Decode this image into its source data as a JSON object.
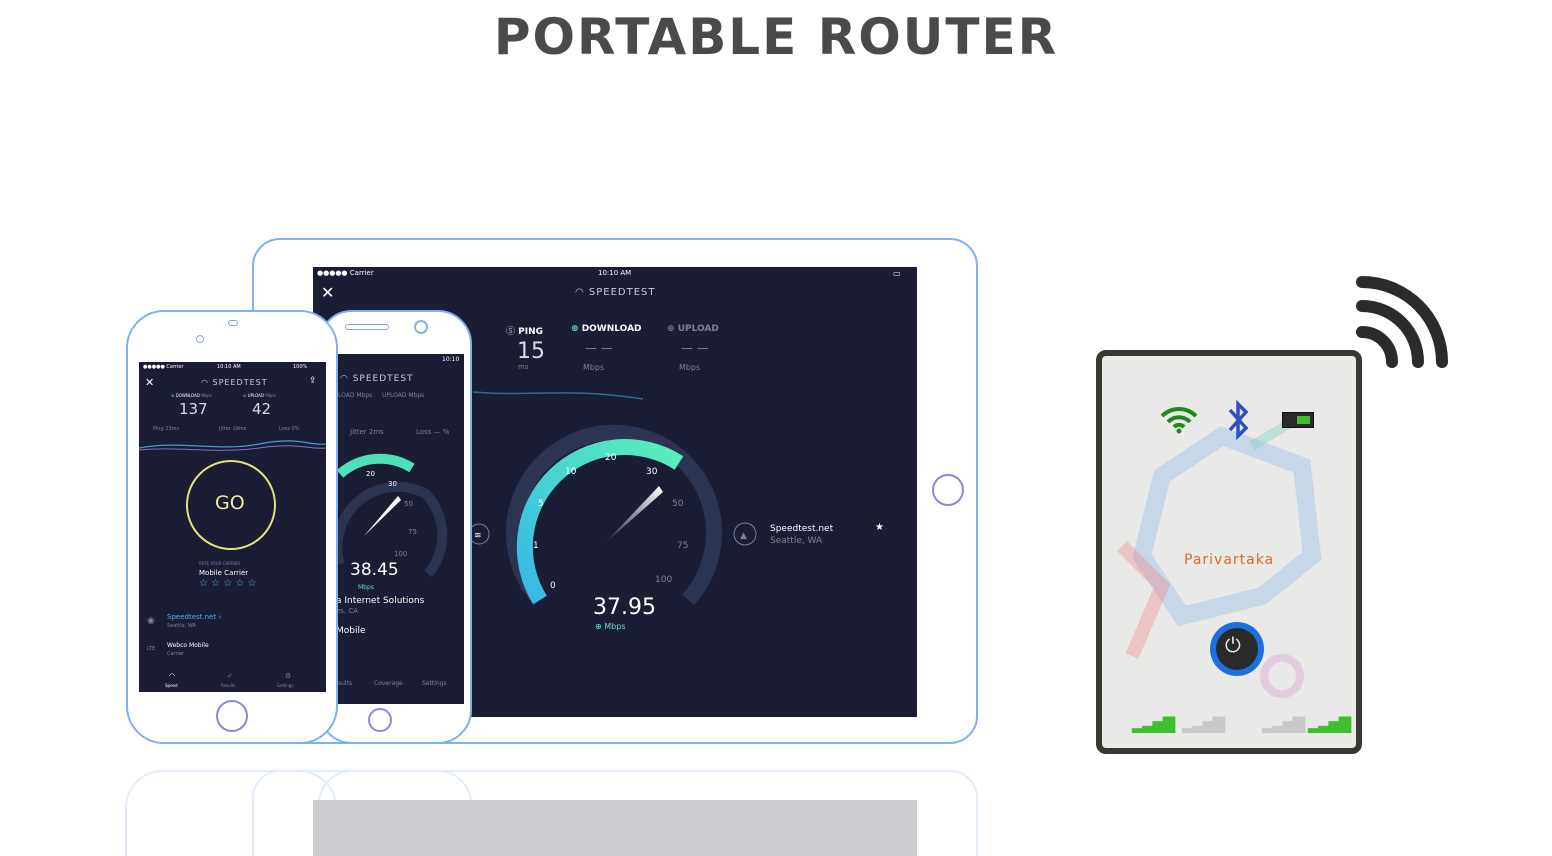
{
  "page": {
    "title": "PORTABLE ROUTER"
  },
  "tablet": {
    "status_carrier": "●●●●● Carrier",
    "status_time": "10:10 AM",
    "app_name": "SPEEDTEST",
    "ping_label": "PING",
    "ping_value": "15",
    "ping_unit": "ms",
    "download_label": "DOWNLOAD",
    "download_value": "— —",
    "download_unit": "Mbps",
    "upload_label": "UPLOAD",
    "upload_value": "— —",
    "upload_unit": "Mbps",
    "gauge_ticks": [
      "0",
      "1",
      "5",
      "10",
      "20",
      "30",
      "50",
      "75",
      "100"
    ],
    "gauge_value": "37.95",
    "gauge_unit": "Mbps",
    "server_name": "Speedtest.net",
    "server_location": "Seattle, WA"
  },
  "phone_mid": {
    "status_time": "10:10",
    "app_name": "SPEEDTEST",
    "download_label": "LOAD Mbps",
    "upload_label": "UPLOAD Mbps",
    "jitter": "Jitter  2ms",
    "loss": "Loss — %",
    "gauge_ticks": [
      "0",
      "20",
      "30",
      "50",
      "75",
      "100"
    ],
    "gauge_value": "38.45",
    "gauge_unit": "Mbps",
    "isp": "a Internet Solutions",
    "isp_loc": "es, CA",
    "carrier": "Mobile",
    "tabs": [
      "sults",
      "Coverage",
      "Settings"
    ]
  },
  "phone_front": {
    "status_carrier": "●●●●● Carrier",
    "status_time": "10:10 AM",
    "status_battery": "100%",
    "app_name": "SPEEDTEST",
    "download_label": "DOWNLOAD",
    "download_unit": "Mbps",
    "download_value": "137",
    "upload_label": "UPLOAD",
    "upload_unit": "Mbps",
    "upload_value": "42",
    "ping": "Ping  23ms",
    "jitter": "Jitter  19ms",
    "loss": "Loss  0%",
    "go_label": "GO",
    "rate_label": "RATE YOUR CARRIER",
    "carrier_name": "Mobile Carrier",
    "stars": "☆ ☆ ☆ ☆ ☆",
    "server_name": "Speedtest.net",
    "server_location": "Seattle, WA",
    "isp_name": "Webco Mobile",
    "isp_type": "Carrier",
    "tabs": [
      "Speed",
      "Results",
      "Settings"
    ]
  },
  "router": {
    "brand": "Parivartaka",
    "colors": {
      "wifi": "#1e8a1e",
      "bluetooth": "#2d4fc4",
      "brand_text": "#e06a2a",
      "power_ring": "#1d6fe0",
      "signal": "#3fbf2f"
    }
  }
}
